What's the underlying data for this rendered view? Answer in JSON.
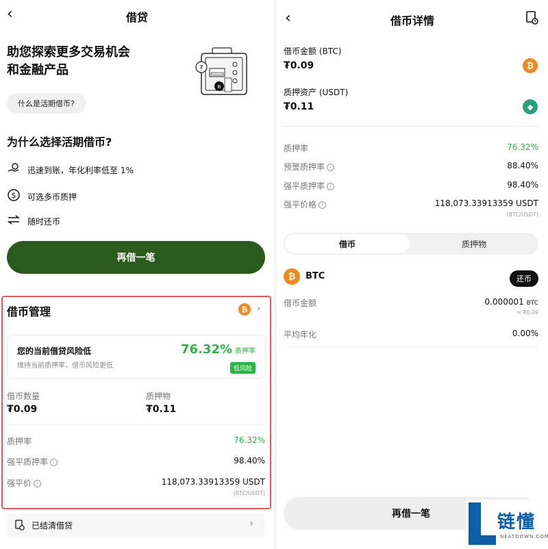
{
  "left": {
    "header_title": "借贷",
    "back_glyph": "‹",
    "hero": {
      "line1": "助您探索更多交易机会",
      "line2": "和金融产品"
    },
    "what_is_button": "什么是活期借币?",
    "why_title": "为什么选择活期借币?",
    "features": [
      {
        "icon": "hand-coin-icon",
        "text": "迅速到账，年化利率低至 1%"
      },
      {
        "icon": "dollar-circle-icon",
        "text": "可选多币质押"
      },
      {
        "icon": "swap-arrows-icon",
        "text": "随时还币"
      }
    ],
    "borrow_again_button": "再借一笔",
    "management": {
      "title": "借币管理",
      "risk_title": "您的当前借贷风险低",
      "risk_sub": "维持当前质押率，借币风险更低",
      "ltv_value": "76.32%",
      "ltv_label": "质押率",
      "risk_tag": "低风险",
      "borrow_qty_label": "借币数量",
      "borrow_qty_value": "₮0.09",
      "collateral_label": "质押物",
      "collateral_value": "₮0.11",
      "rows": [
        {
          "label": "质押率",
          "value": "76.32%"
        },
        {
          "label": "强平质押率",
          "value": "98.40%"
        },
        {
          "label": "强平价",
          "value": "118,073.33913359 USDT"
        }
      ],
      "price_unit": "(BTC/USDT)"
    },
    "settled_label": "已结清借贷"
  },
  "right": {
    "header_title": "借币详情",
    "borrow_amount_label": "借币金额 (BTC)",
    "borrow_amount_value": "₮0.09",
    "collateral_label": "质押资产 (USDT)",
    "collateral_value": "₮0.11",
    "rows": [
      {
        "label": "质押率",
        "value": "76.32%"
      },
      {
        "label": "预警质押率",
        "value": "88.40%"
      },
      {
        "label": "强平质押率",
        "value": "98.40%"
      },
      {
        "label": "强平价格",
        "value": "118,073.33913359 USDT"
      }
    ],
    "price_unit": "(BTC/USDT)",
    "tabs": [
      "借币",
      "质押物"
    ],
    "coin_name": "BTC",
    "repay_button": "还币",
    "coin_rows": {
      "amount_label": "借币金额",
      "amount_value": "0.000001",
      "amount_unit": "BTC",
      "amount_approx": "≈ ₮0.09",
      "apr_label": "平均年化",
      "apr_value": "0.00%"
    },
    "borrow_again_button": "再借一笔"
  },
  "watermark": {
    "text": "链懂",
    "sub": "NEATDOWN.COM",
    "letter": "L"
  },
  "colors": {
    "primary_green": "#2a5a1c",
    "ltv_green": "#2fb344",
    "highlight_red": "#e05a5a",
    "btc_orange": "#f0891f",
    "usdt_teal": "#26a17b"
  }
}
